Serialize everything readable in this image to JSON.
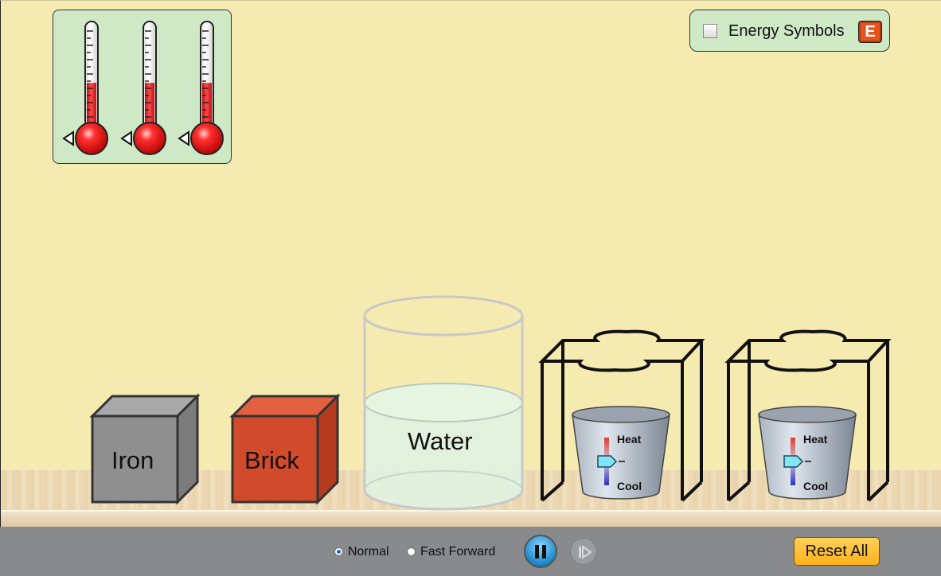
{
  "thermometers": [
    {
      "name": "thermometer-1",
      "fill_fraction": 0.32
    },
    {
      "name": "thermometer-2",
      "fill_fraction": 0.32
    },
    {
      "name": "thermometer-3",
      "fill_fraction": 0.32
    }
  ],
  "energy_panel": {
    "label": "Energy Symbols",
    "badge": "E",
    "checked": false
  },
  "objects": {
    "iron_label": "Iron",
    "brick_label": "Brick",
    "water_label": "Water"
  },
  "burners": [
    {
      "heat_label": "Heat",
      "cool_label": "Cool"
    },
    {
      "heat_label": "Heat",
      "cool_label": "Cool"
    }
  ],
  "controls": {
    "normal_label": "Normal",
    "fast_forward_label": "Fast Forward",
    "selected_speed": "Normal",
    "reset_label": "Reset All"
  },
  "colors": {
    "background": "#f5ebb0",
    "panel": "#cfe9c7",
    "iron": "#8f8f8f",
    "brick": "#d14a2c",
    "reset_button": "#ffbf33",
    "thermometer_liquid": "#e02020"
  }
}
